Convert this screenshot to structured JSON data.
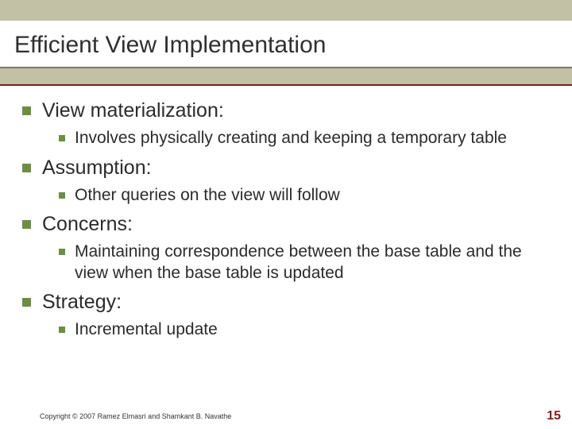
{
  "title": "Efficient View Implementation",
  "items": [
    {
      "label": "View materialization:",
      "sub": [
        {
          "label": "Involves physically creating and keeping a temporary table"
        }
      ]
    },
    {
      "label": "Assumption:",
      "sub": [
        {
          "label": "Other queries on the view will follow"
        }
      ]
    },
    {
      "label": "Concerns:",
      "sub": [
        {
          "label": "Maintaining correspondence between the base table and the view when the base table is updated"
        }
      ]
    },
    {
      "label": "Strategy:",
      "sub": [
        {
          "label": "Incremental update"
        }
      ]
    }
  ],
  "footer": {
    "copyright": "Copyright © 2007 Ramez Elmasri and Shamkant B. Navathe",
    "page": "15"
  }
}
